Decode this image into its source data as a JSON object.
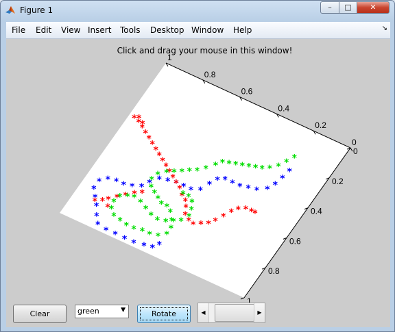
{
  "window": {
    "title": "Figure 1",
    "min_glyph": "–",
    "max_glyph": "□",
    "close_glyph": "✕"
  },
  "menubar": {
    "items": [
      "File",
      "Edit",
      "View",
      "Insert",
      "Tools",
      "Desktop",
      "Window",
      "Help"
    ],
    "dock_glyph": "↘"
  },
  "figure": {
    "title": "Click and drag your mouse in this window!"
  },
  "controls": {
    "clear_label": "Clear",
    "color_select_value": "green",
    "rotate_label": "Rotate",
    "slider_left_glyph": "◀",
    "slider_right_glyph": "▶"
  },
  "chart_data": {
    "type": "scatter",
    "xlim": [
      0,
      1
    ],
    "ylim": [
      0,
      1
    ],
    "x_ticks": [
      "0",
      "0.2",
      "0.4",
      "0.6",
      "0.8",
      "1"
    ],
    "y_ticks": [
      "0",
      "0.2",
      "0.4",
      "0.6",
      "0.8",
      "1"
    ],
    "marker": "*",
    "colors": {
      "red": "#ff0000",
      "green": "#00dd00",
      "blue": "#0000ff"
    },
    "series": [
      {
        "color": "blue",
        "points": [
          [
            0.18,
            0.26
          ],
          [
            0.19,
            0.31
          ],
          [
            0.2,
            0.36
          ],
          [
            0.22,
            0.4
          ],
          [
            0.26,
            0.43
          ],
          [
            0.3,
            0.44
          ],
          [
            0.34,
            0.45
          ],
          [
            0.38,
            0.45
          ],
          [
            0.42,
            0.45
          ],
          [
            0.45,
            0.47
          ],
          [
            0.47,
            0.51
          ],
          [
            0.49,
            0.56
          ],
          [
            0.53,
            0.58
          ],
          [
            0.57,
            0.58
          ],
          [
            0.61,
            0.58
          ],
          [
            0.65,
            0.59
          ],
          [
            0.69,
            0.6
          ],
          [
            0.72,
            0.64
          ],
          [
            0.74,
            0.68
          ],
          [
            0.78,
            0.7
          ],
          [
            0.82,
            0.71
          ],
          [
            0.86,
            0.71
          ],
          [
            0.9,
            0.72
          ],
          [
            0.93,
            0.75
          ],
          [
            0.93,
            0.8
          ],
          [
            0.9,
            0.84
          ],
          [
            0.87,
            0.88
          ],
          [
            0.84,
            0.93
          ],
          [
            0.81,
            0.97
          ],
          [
            0.76,
            0.98
          ],
          [
            0.71,
            0.98
          ],
          [
            0.66,
            0.98
          ],
          [
            0.61,
            0.98
          ],
          [
            0.56,
            0.97
          ],
          [
            0.52,
            0.96
          ],
          [
            0.5,
            0.93
          ]
        ]
      },
      {
        "color": "red",
        "points": [
          [
            0.2,
            0.55
          ],
          [
            0.22,
            0.55
          ],
          [
            0.25,
            0.55
          ],
          [
            0.28,
            0.57
          ],
          [
            0.3,
            0.6
          ],
          [
            0.32,
            0.64
          ],
          [
            0.34,
            0.68
          ],
          [
            0.36,
            0.71
          ],
          [
            0.39,
            0.73
          ],
          [
            0.42,
            0.75
          ],
          [
            0.45,
            0.74
          ],
          [
            0.48,
            0.72
          ],
          [
            0.5,
            0.68
          ],
          [
            0.52,
            0.65
          ],
          [
            0.55,
            0.63
          ],
          [
            0.58,
            0.6
          ],
          [
            0.61,
            0.58
          ],
          [
            0.64,
            0.56
          ],
          [
            0.67,
            0.54
          ],
          [
            0.7,
            0.52
          ],
          [
            0.73,
            0.5
          ],
          [
            0.76,
            0.48
          ],
          [
            0.79,
            0.46
          ],
          [
            0.82,
            0.44
          ],
          [
            0.85,
            0.42
          ],
          [
            0.88,
            0.4
          ],
          [
            0.91,
            0.38
          ],
          [
            0.94,
            0.36
          ],
          [
            0.97,
            0.35
          ],
          [
            0.92,
            0.36
          ],
          [
            0.95,
            0.34
          ],
          [
            0.72,
            0.71
          ],
          [
            0.75,
            0.73
          ],
          [
            0.78,
            0.76
          ],
          [
            0.81,
            0.79
          ],
          [
            0.84,
            0.82
          ],
          [
            0.82,
            0.86
          ],
          [
            0.86,
            0.84
          ],
          [
            0.89,
            0.86
          ]
        ]
      },
      {
        "color": "green",
        "points": [
          [
            0.2,
            0.18
          ],
          [
            0.22,
            0.22
          ],
          [
            0.24,
            0.26
          ],
          [
            0.27,
            0.29
          ],
          [
            0.3,
            0.31
          ],
          [
            0.33,
            0.32
          ],
          [
            0.36,
            0.33
          ],
          [
            0.39,
            0.34
          ],
          [
            0.42,
            0.35
          ],
          [
            0.45,
            0.36
          ],
          [
            0.48,
            0.37
          ],
          [
            0.5,
            0.4
          ],
          [
            0.53,
            0.44
          ],
          [
            0.56,
            0.47
          ],
          [
            0.59,
            0.49
          ],
          [
            0.62,
            0.51
          ],
          [
            0.65,
            0.53
          ],
          [
            0.68,
            0.55
          ],
          [
            0.71,
            0.58
          ],
          [
            0.72,
            0.62
          ],
          [
            0.7,
            0.66
          ],
          [
            0.67,
            0.68
          ],
          [
            0.64,
            0.7
          ],
          [
            0.61,
            0.72
          ],
          [
            0.58,
            0.72
          ],
          [
            0.55,
            0.74
          ],
          [
            0.52,
            0.78
          ],
          [
            0.5,
            0.82
          ],
          [
            0.5,
            0.86
          ],
          [
            0.53,
            0.89
          ],
          [
            0.57,
            0.9
          ],
          [
            0.61,
            0.9
          ],
          [
            0.65,
            0.91
          ],
          [
            0.69,
            0.91
          ],
          [
            0.73,
            0.9
          ],
          [
            0.77,
            0.89
          ],
          [
            0.8,
            0.86
          ],
          [
            0.81,
            0.82
          ],
          [
            0.8,
            0.78
          ],
          [
            0.77,
            0.76
          ],
          [
            0.74,
            0.75
          ],
          [
            0.7,
            0.76
          ],
          [
            0.66,
            0.78
          ],
          [
            0.62,
            0.8
          ],
          [
            0.58,
            0.81
          ],
          [
            0.54,
            0.8
          ],
          [
            0.51,
            0.78
          ],
          [
            0.48,
            0.76
          ],
          [
            0.46,
            0.72
          ],
          [
            0.47,
            0.68
          ],
          [
            0.49,
            0.64
          ],
          [
            0.52,
            0.62
          ],
          [
            0.55,
            0.62
          ]
        ]
      }
    ]
  }
}
